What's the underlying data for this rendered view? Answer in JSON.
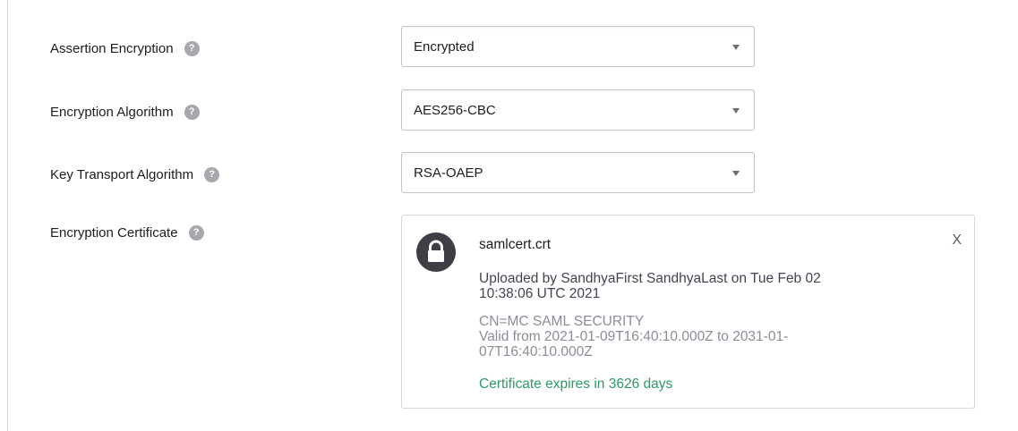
{
  "fields": [
    {
      "label": "Assertion Encryption",
      "value": "Encrypted"
    },
    {
      "label": "Encryption Algorithm",
      "value": "AES256-CBC"
    },
    {
      "label": "Key Transport Algorithm",
      "value": "RSA-OAEP"
    }
  ],
  "certificate": {
    "label": "Encryption Certificate",
    "file_name": "samlcert.crt",
    "close_label": "X",
    "uploaded_line1": "Uploaded by SandhyaFirst SandhyaLast on Tue Feb 02",
    "uploaded_line2": "10:38:06 UTC 2021",
    "cn": "CN=MC SAML SECURITY",
    "valid_line1": "Valid from 2021-01-09T16:40:10.000Z to 2031-01-",
    "valid_line2": "07T16:40:10.000Z",
    "expiry": "Certificate expires in 3626 days"
  },
  "help_glyph": "?",
  "icons": {
    "help": "help-icon",
    "caret": "chevron-down-icon",
    "lock": "lock-icon",
    "close": "close-icon"
  },
  "colors": {
    "expiry_text": "#2b9b66",
    "help_icon_bg": "#a7a7ad",
    "lock_bg": "#3e3e44"
  }
}
